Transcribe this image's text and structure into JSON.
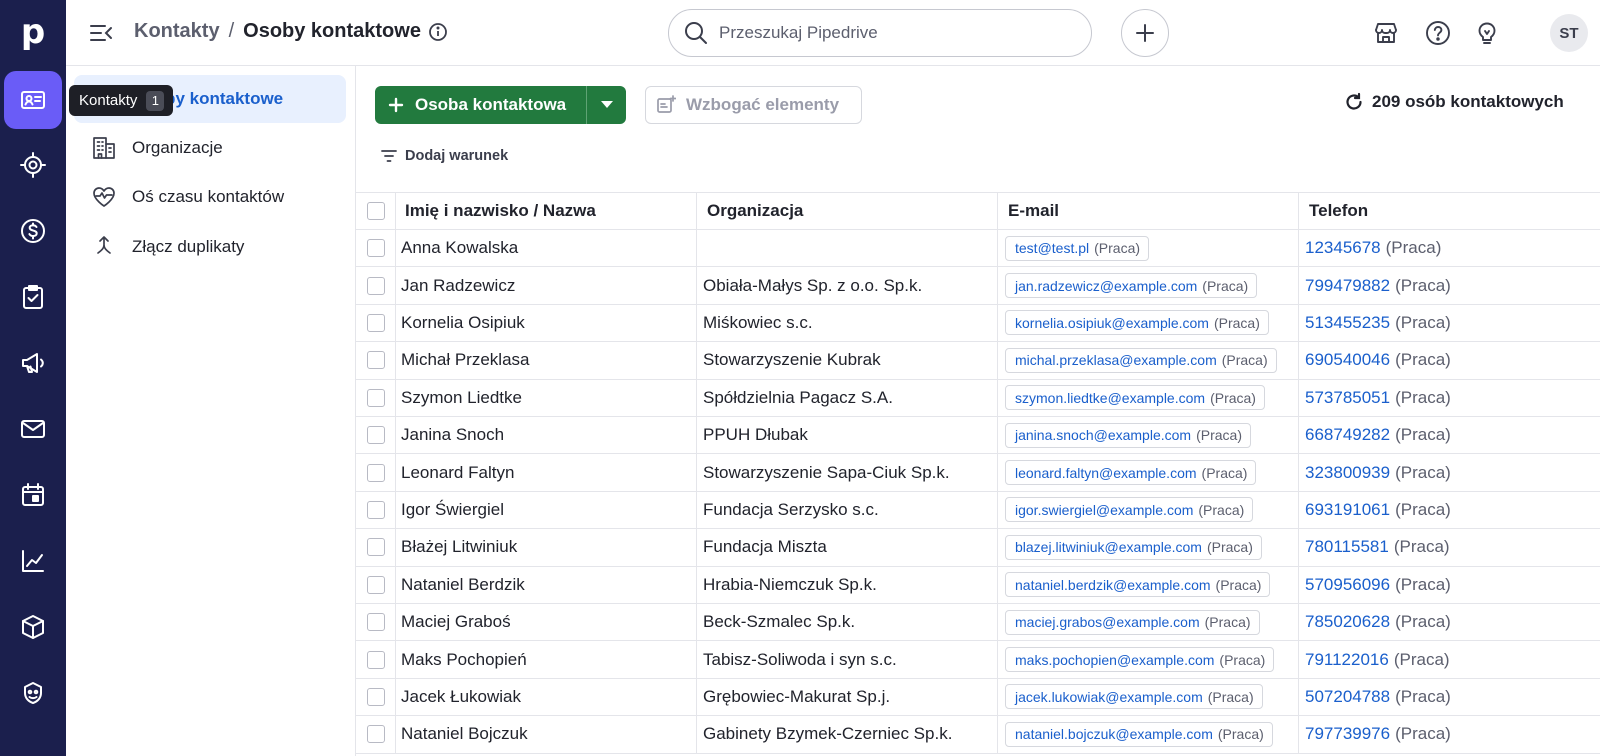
{
  "topbar": {
    "breadcrumb_parent": "Kontakty",
    "breadcrumb_separator": "/",
    "breadcrumb_current": "Osoby kontaktowe",
    "search_placeholder": "Przeszukaj Pipedrive",
    "avatar_initials": "ST"
  },
  "rail": {
    "logo": "p",
    "icons": [
      "contacts-icon",
      "target-icon",
      "dollar-icon",
      "clipboard-check-icon",
      "megaphone-icon",
      "mail-icon",
      "calendar-icon",
      "chart-icon",
      "box-icon",
      "campaign-icon"
    ]
  },
  "tooltip": {
    "label": "Kontakty",
    "shortcut": "1"
  },
  "sidebar": {
    "items": [
      {
        "label": "Osoby kontaktowe",
        "icon": "person-icon",
        "active": true
      },
      {
        "label": "Organizacje",
        "icon": "building-icon",
        "active": false
      },
      {
        "label": "Oś czasu kontaktów",
        "icon": "heart-pulse-icon",
        "active": false
      },
      {
        "label": "Złącz duplikaty",
        "icon": "merge-icon",
        "active": false
      }
    ]
  },
  "toolbar": {
    "add_label": "Osoba kontaktowa",
    "enrich_label": "Wzbogać elementy",
    "count_label": "209 osób kontaktowych",
    "filter_label": "Dodaj warunek"
  },
  "table": {
    "headers": [
      "Imię i nazwisko / Nazwa",
      "Organizacja",
      "E-mail",
      "Telefon"
    ],
    "rows": [
      {
        "name": "Anna Kowalska",
        "org": "",
        "email": "test@test.pl",
        "email_tag": "(Praca)",
        "phone": "12345678",
        "phone_tag": "(Praca)"
      },
      {
        "name": "Jan Radzewicz",
        "org": "Obiała-Małys Sp. z o.o. Sp.k.",
        "email": "jan.radzewicz@example.com",
        "email_tag": "(Praca)",
        "phone": "799479882",
        "phone_tag": "(Praca)"
      },
      {
        "name": "Kornelia Osipiuk",
        "org": "Miśkowiec s.c.",
        "email": "kornelia.osipiuk@example.com",
        "email_tag": "(Praca)",
        "phone": "513455235",
        "phone_tag": "(Praca)"
      },
      {
        "name": "Michał Przeklasa",
        "org": "Stowarzyszenie Kubrak",
        "email": "michal.przeklasa@example.com",
        "email_tag": "(Praca)",
        "phone": "690540046",
        "phone_tag": "(Praca)"
      },
      {
        "name": "Szymon Liedtke",
        "org": "Spółdzielnia Pagacz S.A.",
        "email": "szymon.liedtke@example.com",
        "email_tag": "(Praca)",
        "phone": "573785051",
        "phone_tag": "(Praca)"
      },
      {
        "name": "Janina Snoch",
        "org": "PPUH Dłubak",
        "email": "janina.snoch@example.com",
        "email_tag": "(Praca)",
        "phone": "668749282",
        "phone_tag": "(Praca)"
      },
      {
        "name": "Leonard Faltyn",
        "org": "Stowarzyszenie Sapa-Ciuk Sp.k.",
        "email": "leonard.faltyn@example.com",
        "email_tag": "(Praca)",
        "phone": "323800939",
        "phone_tag": "(Praca)"
      },
      {
        "name": "Igor Świergiel",
        "org": "Fundacja Serzysko s.c.",
        "email": "igor.swiergiel@example.com",
        "email_tag": "(Praca)",
        "phone": "693191061",
        "phone_tag": "(Praca)"
      },
      {
        "name": "Błażej Litwiniuk",
        "org": "Fundacja Miszta",
        "email": "blazej.litwiniuk@example.com",
        "email_tag": "(Praca)",
        "phone": "780115581",
        "phone_tag": "(Praca)"
      },
      {
        "name": "Nataniel Berdzik",
        "org": "Hrabia-Niemczuk Sp.k.",
        "email": "nataniel.berdzik@example.com",
        "email_tag": "(Praca)",
        "phone": "570956096",
        "phone_tag": "(Praca)"
      },
      {
        "name": "Maciej Graboś",
        "org": "Beck-Szmalec Sp.k.",
        "email": "maciej.grabos@example.com",
        "email_tag": "(Praca)",
        "phone": "785020628",
        "phone_tag": "(Praca)"
      },
      {
        "name": "Maks Pochopień",
        "org": "Tabisz-Soliwoda i syn s.c.",
        "email": "maks.pochopien@example.com",
        "email_tag": "(Praca)",
        "phone": "791122016",
        "phone_tag": "(Praca)"
      },
      {
        "name": "Jacek Łukowiak",
        "org": "Grębowiec-Makurat Sp.j.",
        "email": "jacek.lukowiak@example.com",
        "email_tag": "(Praca)",
        "phone": "507204788",
        "phone_tag": "(Praca)"
      },
      {
        "name": "Nataniel Bojczuk",
        "org": "Gabinety Bzymek-Czerniec Sp.k.",
        "email": "nataniel.bojczuk@example.com",
        "email_tag": "(Praca)",
        "phone": "797739976",
        "phone_tag": "(Praca)"
      }
    ]
  },
  "colors": {
    "rail": "#1b1f4d",
    "rail_active": "#6a5cf7",
    "primary_button": "#227a3e",
    "link": "#1a5fcc",
    "sidebar_active_bg": "#e8f0fe"
  }
}
